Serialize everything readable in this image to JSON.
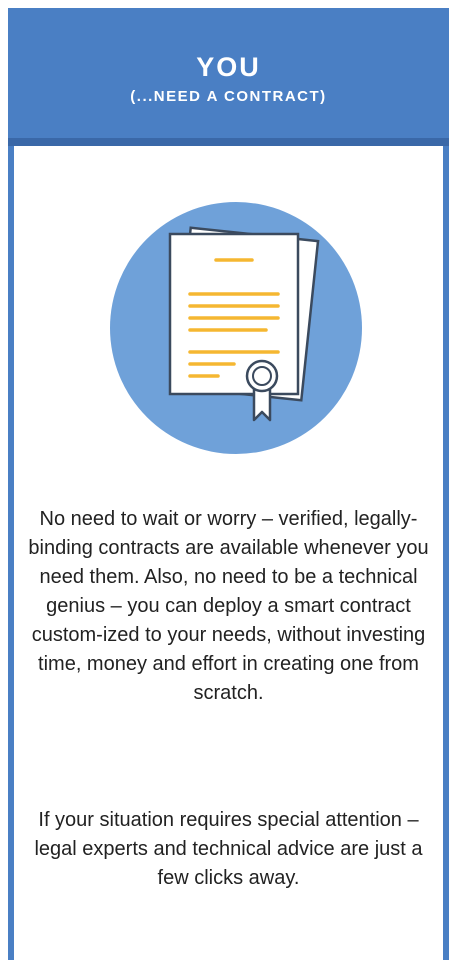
{
  "header": {
    "title": "YOU",
    "subtitle": "(...NEED A CONTRACT)"
  },
  "illustration": {
    "icon": "contract-document-icon",
    "circle_color": "#6fa1d9",
    "paper_color": "#ffffff",
    "line_color": "#f5b731"
  },
  "paragraphs": [
    "No need to wait or worry – verified, legally-binding contracts are available whenever you need them. Also, no need to be a technical genius – you can deploy a smart contract custom-ized to your needs, without investing time, money and effort in creating one from scratch.",
    "If your situation requires special attention – legal experts and technical advice are just a few clicks away."
  ],
  "colors": {
    "brand_blue": "#4a7fc4",
    "accent_yellow": "#f5b731"
  }
}
